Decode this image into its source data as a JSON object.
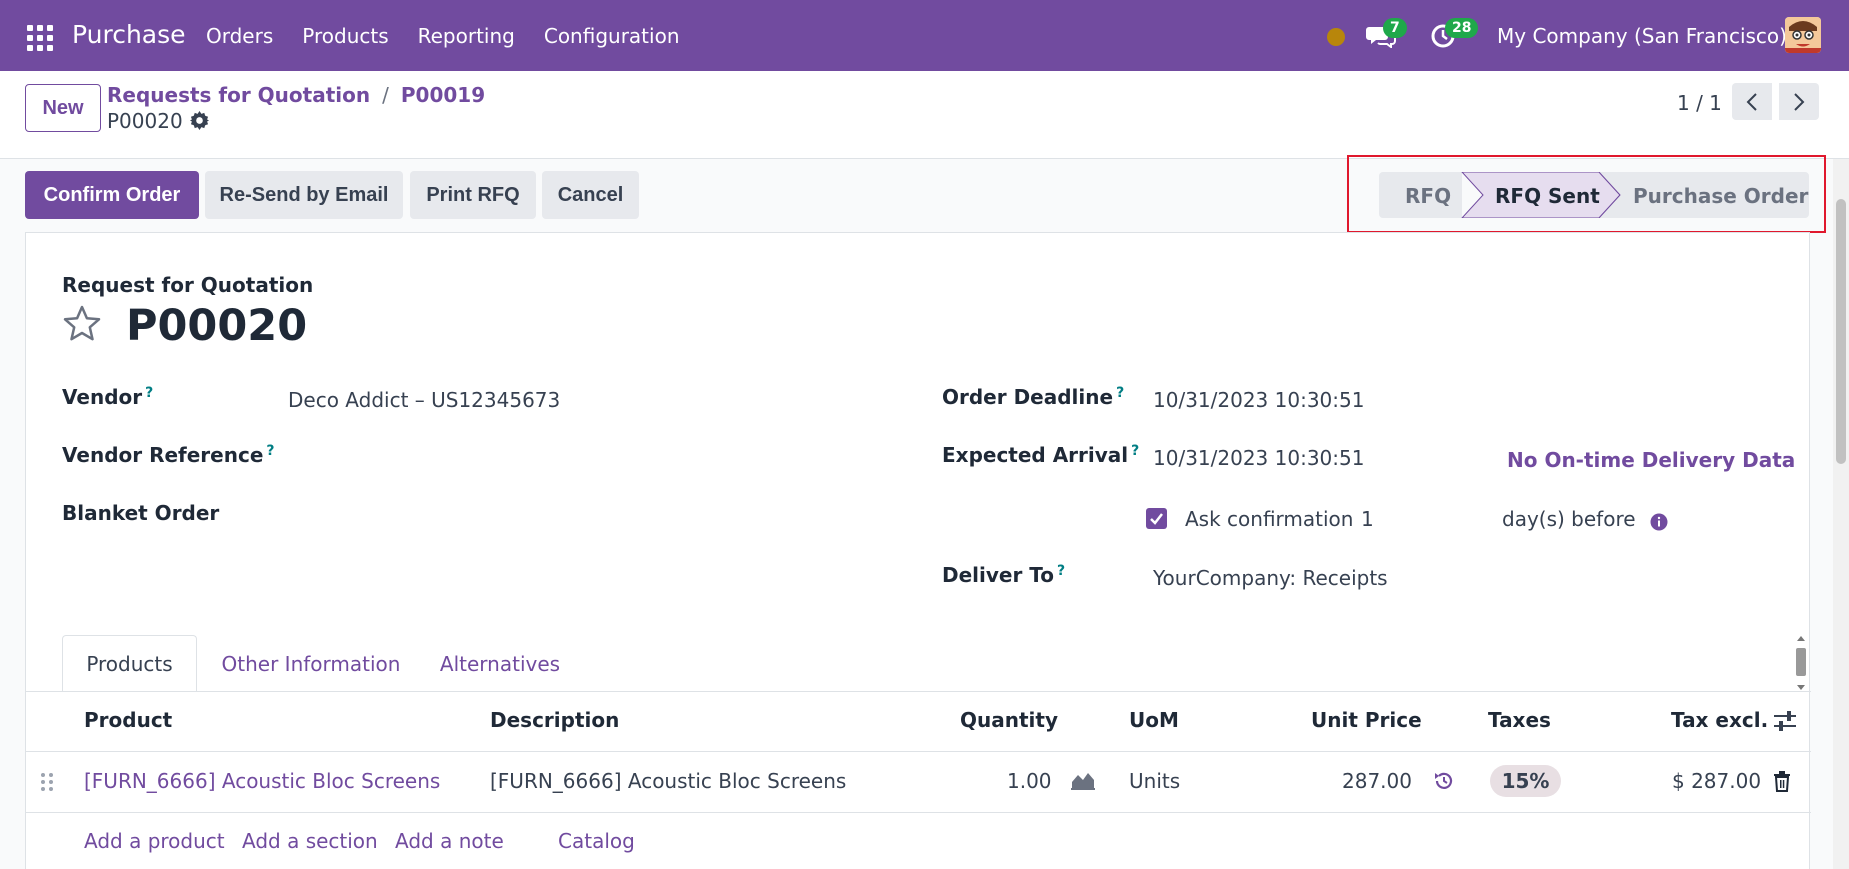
{
  "navbar": {
    "app_name": "Purchase",
    "menu": [
      "Orders",
      "Products",
      "Reporting",
      "Configuration"
    ],
    "messages_count": "7",
    "activities_count": "28",
    "company": "My Company (San Francisco)"
  },
  "control_panel": {
    "new_label": "New",
    "breadcrumb": [
      "Requests for Quotation",
      "P00019"
    ],
    "separator": "/",
    "record_name": "P00020",
    "pager_value": "1 / 1"
  },
  "actions": {
    "confirm_order": "Confirm Order",
    "resend_email": "Re-Send by Email",
    "print_rfq": "Print RFQ",
    "cancel": "Cancel"
  },
  "statusbar": {
    "stages": [
      "RFQ",
      "RFQ Sent",
      "Purchase Order"
    ],
    "current": "RFQ Sent"
  },
  "form": {
    "subtitle": "Request for Quotation",
    "name": "P00020",
    "help_mark": "?",
    "vendor_label": "Vendor",
    "vendor_value": "Deco Addict – US12345673",
    "vendor_ref_label": "Vendor Reference",
    "blanket_label": "Blanket Order",
    "deadline_label": "Order Deadline",
    "deadline_value": "10/31/2023 10:30:51",
    "arrival_label": "Expected Arrival",
    "arrival_value": "10/31/2023 10:30:51",
    "delivery_data_label": "No On-time Delivery Data",
    "ask_confirmation_label": "Ask confirmation",
    "ask_confirmation_checked": true,
    "ask_days": "1",
    "days_before": "day(s) before",
    "deliver_to_label": "Deliver To",
    "deliver_to_value": "YourCompany: Receipts"
  },
  "tabs": [
    "Products",
    "Other Information",
    "Alternatives"
  ],
  "table": {
    "headers": [
      "Product",
      "Description",
      "Quantity",
      "UoM",
      "Unit Price",
      "Taxes",
      "Tax excl."
    ],
    "rows": [
      {
        "product": "[FURN_6666] Acoustic Bloc Screens",
        "description": "[FURN_6666] Acoustic Bloc Screens",
        "quantity": "1.00",
        "uom": "Units",
        "unit_price": "287.00",
        "taxes": "15%",
        "subtotal": "$ 287.00"
      }
    ],
    "add_links": [
      "Add a product",
      "Add a section",
      "Add a note",
      "Catalog"
    ]
  },
  "colors": {
    "brand": "#714b9f",
    "highlight": "#e0182d",
    "badge": "#1fa84a"
  }
}
